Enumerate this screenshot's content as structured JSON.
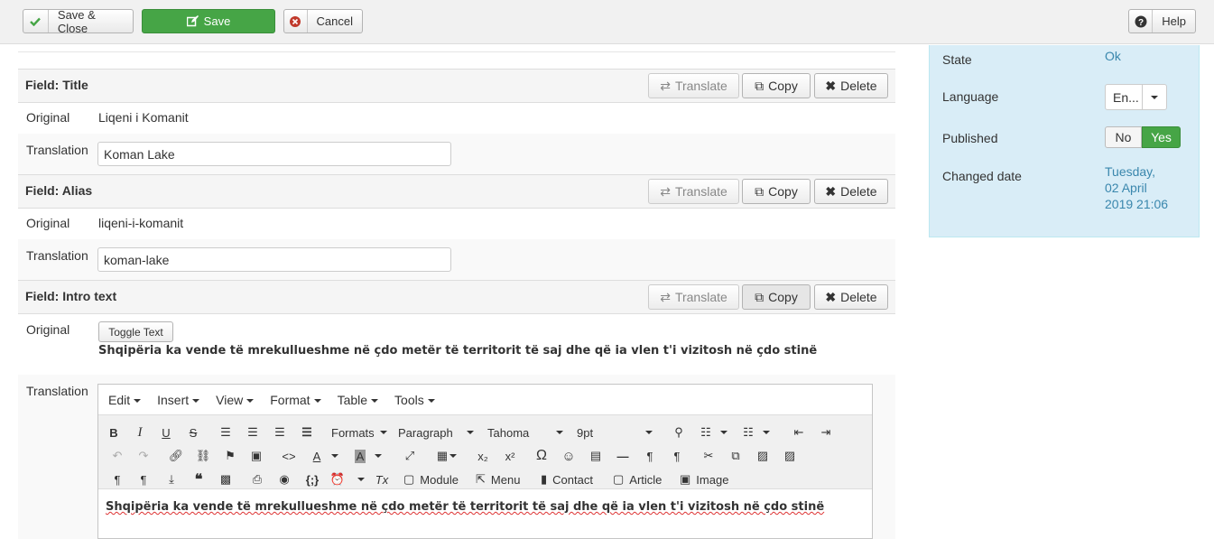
{
  "toolbar": {
    "save_close": "Save & Close",
    "save": "Save",
    "cancel": "Cancel",
    "help": "Help"
  },
  "fields": [
    {
      "header": "Field: Title",
      "original_label": "Original",
      "original": "Liqeni i Komanit",
      "translation_label": "Translation",
      "translation": "Koman Lake"
    },
    {
      "header": "Field: Alias",
      "original_label": "Original",
      "original": "liqeni-i-komanit",
      "translation_label": "Translation",
      "translation": "koman-lake"
    },
    {
      "header": "Field: Intro text",
      "original_label": "Original",
      "toggle": "Toggle Text",
      "original": "Shqipëria ka vende të mrekullueshme në çdo metër të territorit të saj dhe që ia vlen t'i vizitosh në çdo stinë",
      "translation_label": "Translation"
    }
  ],
  "actions": {
    "translate": "Translate",
    "copy": "Copy",
    "delete": "Delete"
  },
  "sidebar": {
    "state_label": "State",
    "state": "Ok",
    "language_label": "Language",
    "language": "En...",
    "published_label": "Published",
    "no": "No",
    "yes": "Yes",
    "changed_label": "Changed date",
    "changed_l1": "Tuesday,",
    "changed_l2": "02 April",
    "changed_l3": "2019 21:06"
  },
  "editor": {
    "menus": [
      "Edit",
      "Insert",
      "View",
      "Format",
      "Table",
      "Tools"
    ],
    "formats": "Formats",
    "paragraph": "Paragraph",
    "font": "Tahoma",
    "size": "9pt",
    "module": "Module",
    "menu": "Menu",
    "contact": "Contact",
    "article": "Article",
    "image": "Image",
    "content": "Shqipëria ka vende të mrekullueshme në çdo metër të territorit të saj dhe që ia vlen t'i vizitosh në çdo stinë"
  },
  "colors": {
    "save": "#46a546",
    "sidebar": "#d9edf7",
    "link": "#3a87ad"
  }
}
